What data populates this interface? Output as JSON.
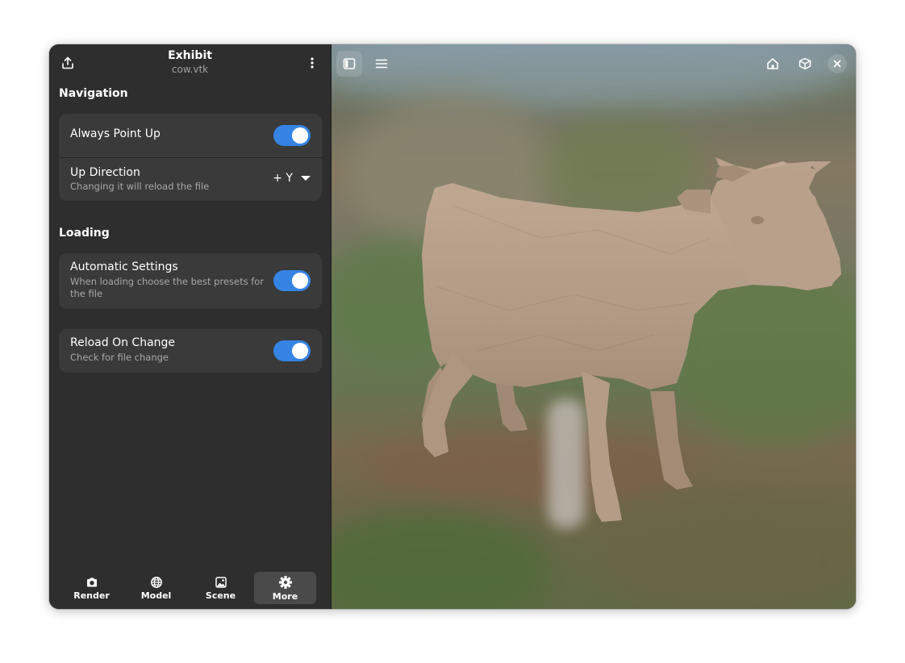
{
  "header": {
    "title": "Exhibit",
    "subtitle": "cow.vtk",
    "export_icon": "share-export-icon",
    "menu_icon": "vertical-dots-icon"
  },
  "navigation": {
    "section_title": "Navigation",
    "always_point_up": {
      "label": "Always Point Up",
      "enabled": true
    },
    "up_direction": {
      "label": "Up Direction",
      "subtitle": "Changing it will reload the file",
      "value": "+ Y"
    }
  },
  "loading": {
    "section_title": "Loading",
    "automatic_settings": {
      "label": "Automatic Settings",
      "subtitle": "When loading choose the best presets for the file",
      "enabled": true
    },
    "reload_on_change": {
      "label": "Reload On Change",
      "subtitle": "Check for file change",
      "enabled": true
    }
  },
  "switcher": {
    "items": [
      {
        "label": "Render",
        "icon": "camera-icon",
        "active": false
      },
      {
        "label": "Model",
        "icon": "globe-icon",
        "active": false
      },
      {
        "label": "Scene",
        "icon": "image-icon",
        "active": false
      },
      {
        "label": "More",
        "icon": "gear-icon",
        "active": true
      }
    ]
  },
  "viewer": {
    "model": "cow",
    "toolbar_left": [
      "sidebar-toggle-icon",
      "hamburger-menu-icon"
    ],
    "toolbar_right": [
      "home-icon",
      "cube-view-icon",
      "close-icon"
    ]
  },
  "colors": {
    "accent": "#3584e4",
    "sidebar_bg": "#2e2e2e",
    "card_bg": "#3a3a3a",
    "model": "#b89e86"
  }
}
